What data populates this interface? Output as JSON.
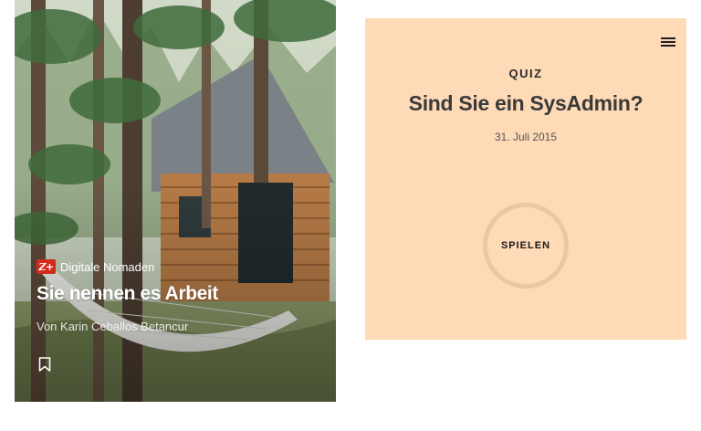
{
  "article": {
    "kicker_badge": "Z+",
    "kicker": "Digitale Nomaden",
    "title": "Sie nennen es Arbeit",
    "byline": "Von Karin Ceballos Betancur",
    "image_icon": "cabin-in-forest-photo",
    "bookmark_icon": "bookmark-icon"
  },
  "quiz": {
    "label": "QUIZ",
    "title": "Sind Sie ein SysAdmin?",
    "date": "31. Juli 2015",
    "play_label": "SPIELEN",
    "menu_icon": "hamburger-menu-icon"
  },
  "colors": {
    "quiz_background": "#fedab7",
    "play_ring": "#ebc7a3",
    "zplus_badge": "#d42a1b"
  }
}
